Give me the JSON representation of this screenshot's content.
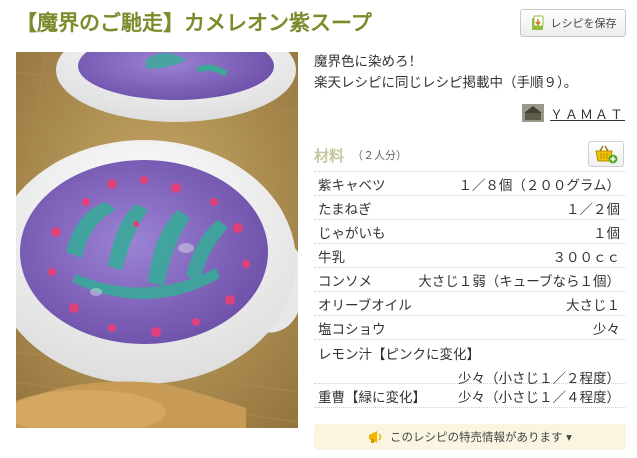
{
  "recipe": {
    "title": "【魔界のご馳走】カメレオン紫スープ",
    "save_label": "レシピを保存",
    "description_lines": [
      "魔界色に染めろ！",
      "楽天レシピに同じレシピ掲載中（手順９）。"
    ],
    "author": "ＹＡＭＡＴ"
  },
  "ingredients": {
    "heading": "材料",
    "servings": "（２人分）",
    "items": [
      {
        "name": "紫キャベツ",
        "qty": "１／８個（２００グラム）"
      },
      {
        "name": "たまねぎ",
        "qty": "１／２個"
      },
      {
        "name": "じゃがいも",
        "qty": "１個"
      },
      {
        "name": "牛乳",
        "qty": "３００ｃｃ"
      },
      {
        "name": "コンソメ",
        "qty": "大さじ１弱（キューブなら１個）"
      },
      {
        "name": "オリーブオイル",
        "qty": "大さじ１"
      },
      {
        "name": "塩コショウ",
        "qty": "少々"
      },
      {
        "name": "レモン汁【ピンクに変化】",
        "qty": "少々（小さじ１／２程度）"
      },
      {
        "name": "重曹【緑に変化】",
        "qty": "少々（小さじ１／４程度）"
      }
    ]
  },
  "sale_info": {
    "label": "このレシピの特売情報があります ▾"
  },
  "icons": {
    "save": "save-download-icon",
    "basket": "add-to-basket-icon",
    "sale": "megaphone-icon"
  },
  "colors": {
    "title": "#7c8c2d",
    "soup": "#8e6fc8",
    "green_pattern": "#3aa99a",
    "pink_dots": "#e0417b"
  }
}
